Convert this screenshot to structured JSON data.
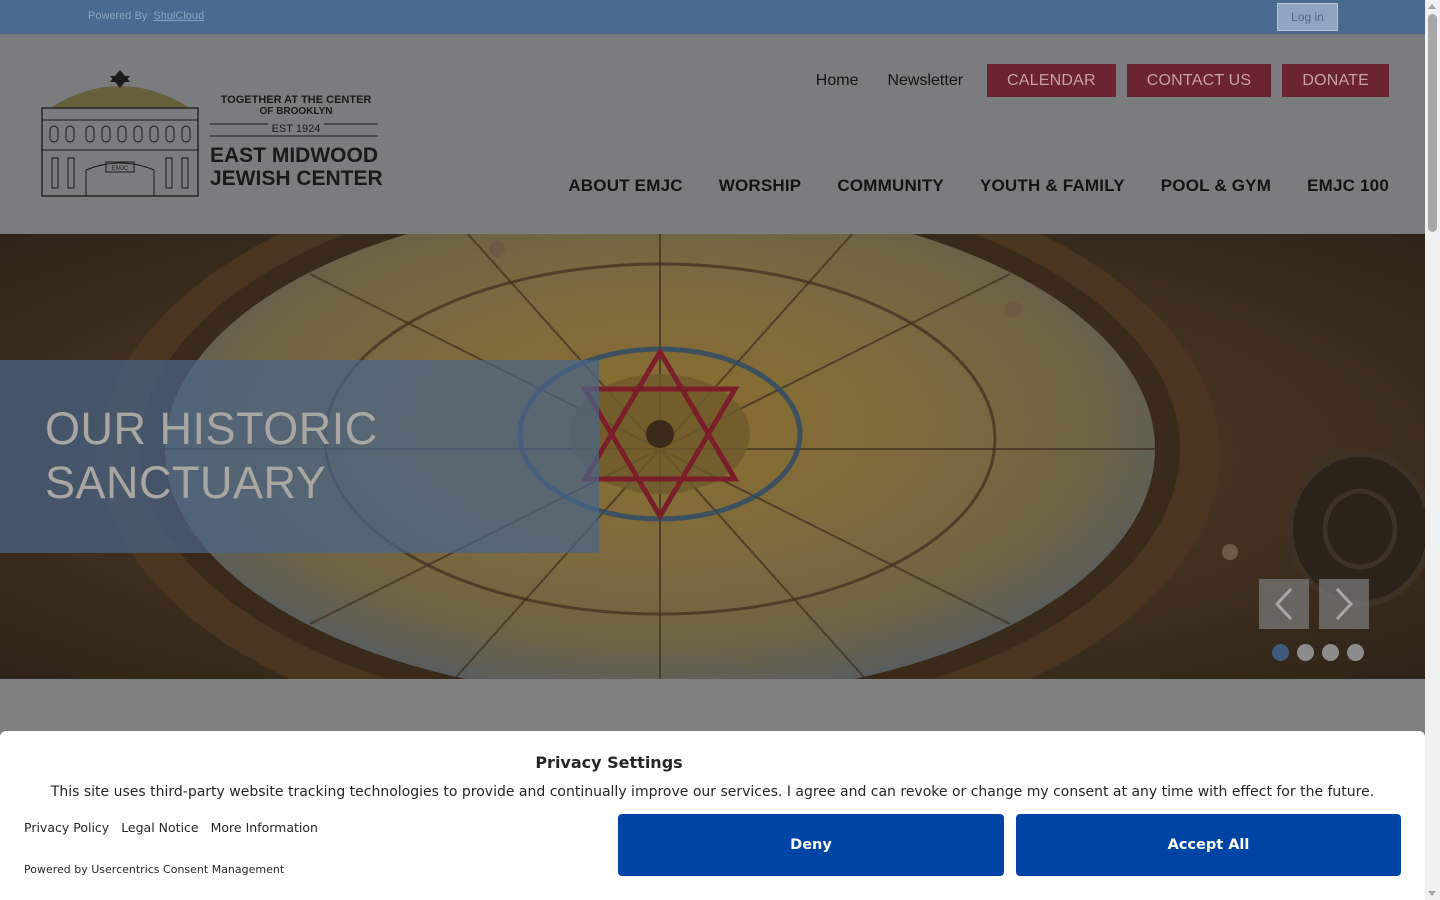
{
  "topbar": {
    "powered_prefix": "Powered By",
    "powered_link": "ShulCloud",
    "login_label": "Log in"
  },
  "logo": {
    "tagline_line1": "TOGETHER AT THE CENTER",
    "tagline_line2": "OF BROOKLYN",
    "established": "EST 1924",
    "name_line1": "EAST MIDWOOD",
    "name_line2": "JEWISH CENTER",
    "building_sign": "EMJC"
  },
  "util_nav": {
    "home": "Home",
    "newsletter": "Newsletter",
    "calendar": "CALENDAR",
    "contact": "CONTACT US",
    "donate": "DONATE"
  },
  "main_nav": {
    "items": [
      "ABOUT EMJC",
      "WORSHIP",
      "COMMUNITY",
      "YOUTH & FAMILY",
      "POOL & GYM",
      "EMJC 100"
    ]
  },
  "hero": {
    "caption": "OUR HISTORIC SANCTUARY",
    "prev_icon": "chevron-left-icon",
    "next_icon": "chevron-right-icon",
    "slide_count": 4,
    "active_slide": 1
  },
  "consent": {
    "title": "Privacy Settings",
    "text": "This site uses third-party website tracking technologies to provide and continually improve our services. I agree and can revoke or change my consent at any time with effect for the future.",
    "links": [
      "Privacy Policy",
      "Legal Notice",
      "More Information"
    ],
    "powered": "Powered by Usercentrics Consent Management",
    "deny": "Deny",
    "accept": "Accept All"
  },
  "colors": {
    "topbar": "#4a6a92",
    "accent_button": "#6b2431",
    "consent_button": "#0045a5"
  }
}
